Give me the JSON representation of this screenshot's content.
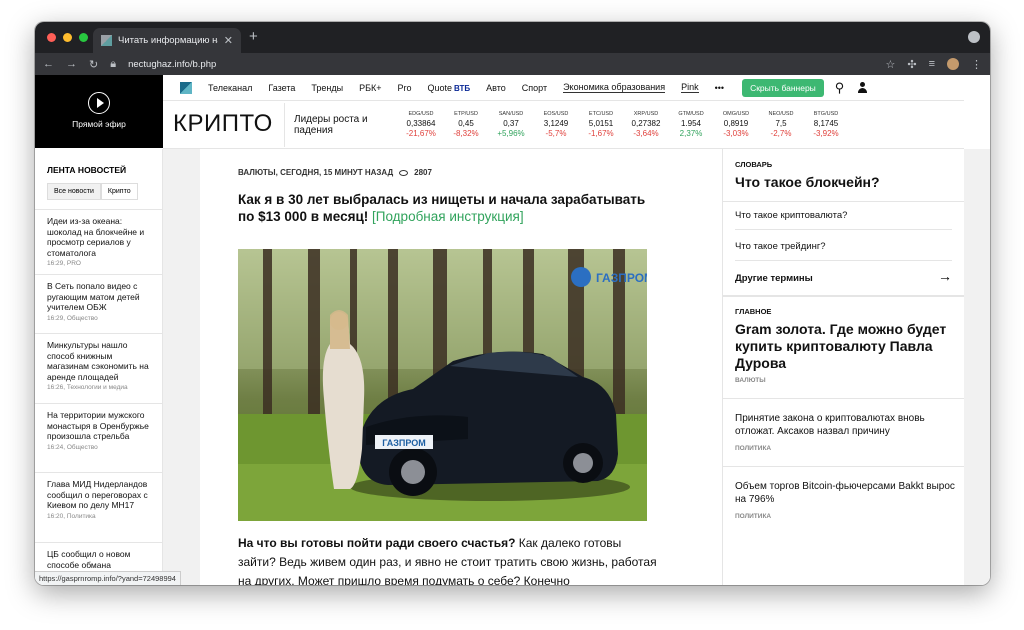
{
  "browser": {
    "tab_title": "Читать информацию на сайте",
    "url": "nectughaz.info/b.php",
    "status_url": "https://gasprnromp.info/?yand=72498994"
  },
  "nav": {
    "items": [
      "Телеканал",
      "Газета",
      "Тренды",
      "РБК+",
      "Pro",
      "Quote",
      "Авто",
      "Спорт",
      "Экономика образования",
      "Pink",
      "•••"
    ],
    "vtb": "ВТБ",
    "hide_banners": "Скрыть баннеры"
  },
  "live": {
    "label": "Прямой эфир"
  },
  "crypto": {
    "title": "КРИПТО",
    "leaders_label": "Лидеры роста и падения",
    "tickers": [
      {
        "name": "EDG/USD",
        "value": "0,33864",
        "change": "-21,67%",
        "dir": "down"
      },
      {
        "name": "ETP/USD",
        "value": "0,45",
        "change": "-8,32%",
        "dir": "down"
      },
      {
        "name": "SAN/USD",
        "value": "0,37",
        "change": "+5,96%",
        "dir": "up"
      },
      {
        "name": "EOS/USD",
        "value": "3,1249",
        "change": "-5,7%",
        "dir": "down"
      },
      {
        "name": "ETC/USD",
        "value": "5,0151",
        "change": "-1,67%",
        "dir": "down"
      },
      {
        "name": "XRP/USD",
        "value": "0,27382",
        "change": "-3,64%",
        "dir": "down"
      },
      {
        "name": "GTM/USD",
        "value": "1.954",
        "change": "2,37%",
        "dir": "up"
      },
      {
        "name": "OMG/USD",
        "value": "0,8919",
        "change": "-3,03%",
        "dir": "down"
      },
      {
        "name": "NEO/USD",
        "value": "7,5",
        "change": "-2,7%",
        "dir": "down"
      },
      {
        "name": "BTG/USD",
        "value": "8,1745",
        "change": "-3,92%",
        "dir": "down"
      }
    ]
  },
  "feed": {
    "heading": "ЛЕНТА НОВОСТЕЙ",
    "tabs": [
      "Все новости",
      "Крипто"
    ],
    "items": [
      {
        "title": "Идеи из-за океана: шоколад на блокчейне и просмотр сериалов у стоматолога",
        "meta": "16:29, PRO"
      },
      {
        "title": "В Сеть попало видео с ругающим матом детей учителем ОБЖ",
        "meta": "16:29, Общество"
      },
      {
        "title": "Минкультуры нашло способ книжным магазинам сэкономить на аренде площадей",
        "meta": "16:26, Технологии и медиа"
      },
      {
        "title": "На территории мужского монастыря в Оренбуржье произошла стрельба",
        "meta": "16:24, Общество"
      },
      {
        "title": "Глава МИД Нидерландов сообщил о переговорах с Киевом по делу МН17",
        "meta": "16:20, Политика"
      },
      {
        "title": "ЦБ сообщил о новом способе обмана",
        "meta": ""
      }
    ]
  },
  "article": {
    "meta": "ВАЛЮТЫ, СЕГОДНЯ, 15 МИНУТ НАЗАД",
    "views": "2807",
    "headline": "Как я в 30 лет выбралась из нищеты и начала зарабатывать по $13 000 в месяц!",
    "headline_link": "[Подробная инструкция]",
    "body_bold": "На что вы готовы пойти ради своего счастья?",
    "body_rest": "Как далеко готовы зайти? Ведь живем один раз, и явно не стоит тратить свою жизнь, работая на других. Может пришло время подумать о себе? Конечно",
    "photo_logo": "ГАЗПРОМ",
    "plate_text": "ГАЗПРОМ"
  },
  "sidebar": {
    "glossary_label": "СЛОВАРЬ",
    "glossary_title": "Что такое блокчейн?",
    "glossary_links": [
      "Что такое криптовалюта?",
      "Что такое трейдинг?"
    ],
    "other_terms": "Другие термины",
    "main_label": "ГЛАВНОЕ",
    "main_title": "Gram золота. Где можно будет купить криптовалюту Павла Дурова",
    "main_tag": "ВАЛЮТЫ",
    "items": [
      {
        "title": "Принятие закона о криптовалютах вновь отложат. Аксаков назвал причину",
        "tag": "ПОЛИТИКА"
      },
      {
        "title": "Объем торгов Bitcoin-фьючерсами Bakkt вырос на 796%",
        "tag": "ПОЛИТИКА"
      }
    ]
  },
  "colors": {
    "accent_green": "#3db872",
    "down_red": "#e0413c",
    "up_green": "#31a35c"
  }
}
